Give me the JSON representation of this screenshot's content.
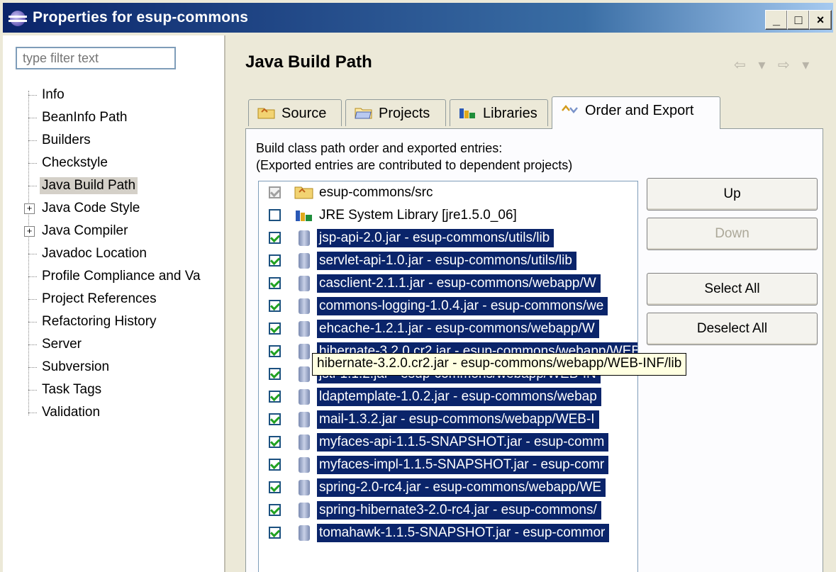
{
  "window": {
    "title": "Properties for esup-commons",
    "controls": {
      "minimize": "_",
      "maximize": "□",
      "close": "×"
    }
  },
  "left_panel": {
    "filter_placeholder": "type filter text",
    "tree": [
      {
        "label": "Info",
        "expandable": false,
        "selected": false
      },
      {
        "label": "BeanInfo Path",
        "expandable": false,
        "selected": false
      },
      {
        "label": "Builders",
        "expandable": false,
        "selected": false
      },
      {
        "label": "Checkstyle",
        "expandable": false,
        "selected": false
      },
      {
        "label": "Java Build Path",
        "expandable": false,
        "selected": true
      },
      {
        "label": "Java Code Style",
        "expandable": true,
        "selected": false
      },
      {
        "label": "Java Compiler",
        "expandable": true,
        "selected": false
      },
      {
        "label": "Javadoc Location",
        "expandable": false,
        "selected": false
      },
      {
        "label": "Profile Compliance and Va",
        "expandable": false,
        "selected": false
      },
      {
        "label": "Project References",
        "expandable": false,
        "selected": false
      },
      {
        "label": "Refactoring History",
        "expandable": false,
        "selected": false
      },
      {
        "label": "Server",
        "expandable": false,
        "selected": false
      },
      {
        "label": "Subversion",
        "expandable": false,
        "selected": false
      },
      {
        "label": "Task Tags",
        "expandable": false,
        "selected": false
      },
      {
        "label": "Validation",
        "expandable": false,
        "selected": false
      }
    ]
  },
  "page": {
    "title": "Java Build Path",
    "nav": "⇦ ▾ ⇨ ▾"
  },
  "tabs": [
    {
      "label": "Source",
      "icon": "source-folder-icon",
      "active": false
    },
    {
      "label": "Projects",
      "icon": "projects-folder-icon",
      "active": false
    },
    {
      "label": "Libraries",
      "icon": "libraries-icon",
      "active": false
    },
    {
      "label": "Order and Export",
      "icon": "order-export-icon",
      "active": true
    }
  ],
  "order_export": {
    "description_line1": "Build class path order and exported entries:",
    "description_line2": "(Exported entries are contributed to dependent projects)",
    "entries": [
      {
        "label": "esup-commons/src",
        "checked": true,
        "disabled": true,
        "selected": false,
        "icon": "source-folder-icon"
      },
      {
        "label": "JRE System Library [jre1.5.0_06]",
        "checked": false,
        "disabled": false,
        "selected": false,
        "icon": "library-icon"
      },
      {
        "label": "jsp-api-2.0.jar - esup-commons/utils/lib",
        "checked": true,
        "disabled": false,
        "selected": true,
        "icon": "jar-icon"
      },
      {
        "label": "servlet-api-1.0.jar - esup-commons/utils/lib",
        "checked": true,
        "disabled": false,
        "selected": true,
        "icon": "jar-icon"
      },
      {
        "label": "casclient-2.1.1.jar - esup-commons/webapp/W",
        "checked": true,
        "disabled": false,
        "selected": true,
        "icon": "jar-icon"
      },
      {
        "label": "commons-logging-1.0.4.jar - esup-commons/we",
        "checked": true,
        "disabled": false,
        "selected": true,
        "icon": "jar-icon"
      },
      {
        "label": "ehcache-1.2.1.jar - esup-commons/webapp/W",
        "checked": true,
        "disabled": false,
        "selected": true,
        "icon": "jar-icon"
      },
      {
        "label": "hibernate-3.2.0.cr2.jar - esup-commons/webapp/WEB-INF/lib",
        "checked": true,
        "disabled": false,
        "selected": true,
        "icon": "jar-icon"
      },
      {
        "label": "jstl-1.1.2.jar - esup-commons/webapp/WEB-IN",
        "checked": true,
        "disabled": false,
        "selected": true,
        "icon": "jar-icon"
      },
      {
        "label": "ldaptemplate-1.0.2.jar - esup-commons/webap",
        "checked": true,
        "disabled": false,
        "selected": true,
        "icon": "jar-icon"
      },
      {
        "label": "mail-1.3.2.jar - esup-commons/webapp/WEB-I",
        "checked": true,
        "disabled": false,
        "selected": true,
        "icon": "jar-icon"
      },
      {
        "label": "myfaces-api-1.1.5-SNAPSHOT.jar - esup-comm",
        "checked": true,
        "disabled": false,
        "selected": true,
        "icon": "jar-icon"
      },
      {
        "label": "myfaces-impl-1.1.5-SNAPSHOT.jar - esup-comr",
        "checked": true,
        "disabled": false,
        "selected": true,
        "icon": "jar-icon"
      },
      {
        "label": "spring-2.0-rc4.jar - esup-commons/webapp/WE",
        "checked": true,
        "disabled": false,
        "selected": true,
        "icon": "jar-icon"
      },
      {
        "label": "spring-hibernate3-2.0-rc4.jar - esup-commons/",
        "checked": true,
        "disabled": false,
        "selected": true,
        "icon": "jar-icon"
      },
      {
        "label": "tomahawk-1.1.5-SNAPSHOT.jar - esup-commor",
        "checked": true,
        "disabled": false,
        "selected": true,
        "icon": "jar-icon"
      }
    ],
    "tooltip": "hibernate-3.2.0.cr2.jar - esup-commons/webapp/WEB-INF/lib",
    "buttons": {
      "up": "Up",
      "down": "Down",
      "select_all": "Select All",
      "deselect_all": "Deselect All"
    }
  },
  "colors": {
    "selection": "#0a246a",
    "titlebar_start": "#0a246a",
    "titlebar_end": "#a6caf0",
    "check_green": "#21a121"
  }
}
